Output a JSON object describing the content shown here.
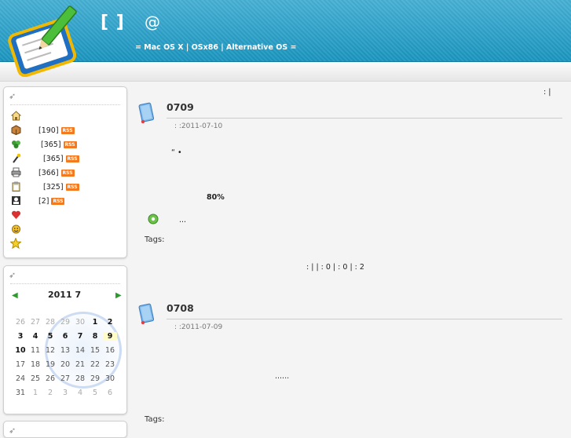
{
  "header": {
    "title": "[ ]",
    "at": "@",
    "subtitle": "= Mac OS X | OSx86 | Alternative OS ="
  },
  "top_right": ":  |",
  "sidebar": {
    "categories": [
      {
        "icon": "home-icon",
        "count": "",
        "rss": ""
      },
      {
        "icon": "box-icon",
        "count": "[190]",
        "rss": "RSS"
      },
      {
        "icon": "clover-icon",
        "count": "[365]",
        "rss": "RSS"
      },
      {
        "icon": "wand-icon",
        "count": "[365]",
        "rss": "RSS"
      },
      {
        "icon": "printer-icon",
        "count": "[366]",
        "rss": "RSS"
      },
      {
        "icon": "clipboard-icon",
        "count": "[325]",
        "rss": "RSS"
      },
      {
        "icon": "contact-icon",
        "count": "[2]",
        "rss": "RSS"
      },
      {
        "icon": "heart-icon",
        "count": "",
        "rss": ""
      },
      {
        "icon": "smiley-icon",
        "count": "",
        "rss": ""
      },
      {
        "icon": "star-icon",
        "count": "",
        "rss": ""
      }
    ],
    "calendar": {
      "month_label": "2011  7",
      "prev": "◀",
      "next": "▶",
      "weeks": [
        [
          "26",
          "27",
          "28",
          "29",
          "30",
          "1",
          "2"
        ],
        [
          "3",
          "4",
          "5",
          "6",
          "7",
          "8",
          "9"
        ],
        [
          "10",
          "11",
          "12",
          "13",
          "14",
          "15",
          "16"
        ],
        [
          "17",
          "18",
          "19",
          "20",
          "21",
          "22",
          "23"
        ],
        [
          "24",
          "25",
          "26",
          "27",
          "28",
          "29",
          "30"
        ],
        [
          "31",
          "1",
          "2",
          "3",
          "4",
          "5",
          "6"
        ]
      ]
    }
  },
  "posts": [
    {
      "title": "0709",
      "meta": ":      :2011-07-10",
      "line1": "“  •",
      "line2": "80%",
      "line3": "...",
      "tags": "Tags:",
      "footer": ":   |     |  : 0 |  : 0 |    : 2"
    },
    {
      "title": "0708",
      "meta": ":      :2011-07-09",
      "line1": "......",
      "tags": "Tags:"
    }
  ]
}
